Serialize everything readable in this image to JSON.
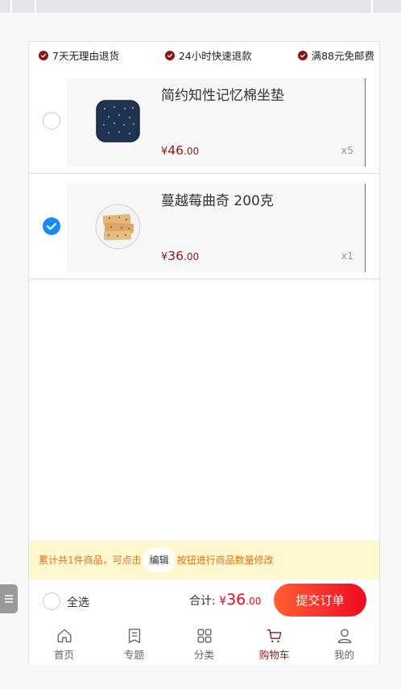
{
  "promises": [
    {
      "icon": "check-icon",
      "text": "7天无理由退货"
    },
    {
      "icon": "check-icon",
      "text": "24小时快速退款"
    },
    {
      "icon": "check-icon",
      "text": "满88元免邮费"
    }
  ],
  "cart": {
    "items": [
      {
        "name": "简约知性记忆棉坐垫",
        "price_symbol": "¥",
        "price_int": "46",
        "price_dec": ".00",
        "qty": "x5",
        "checked": false,
        "image": "cushion-image"
      },
      {
        "name": "蔓越莓曲奇 200克",
        "price_symbol": "¥",
        "price_int": "36",
        "price_dec": ".00",
        "qty": "x1",
        "checked": true,
        "image": "cookies-image"
      }
    ]
  },
  "notice": {
    "before": "累计共1件商品，可点击",
    "edit_label": "编辑",
    "after": "按钮进行商品数量修改"
  },
  "submit_bar": {
    "select_all_label": "全选",
    "total_label": "合计:",
    "total_symbol": "¥",
    "total_int": "36",
    "total_dec": ".00",
    "submit_label": "提交订单"
  },
  "tabbar": [
    {
      "icon": "home-icon",
      "label": "首页",
      "active": false
    },
    {
      "icon": "topic-icon",
      "label": "专题",
      "active": false
    },
    {
      "icon": "category-icon",
      "label": "分类",
      "active": false
    },
    {
      "icon": "cart-icon",
      "label": "购物车",
      "active": true
    },
    {
      "icon": "user-icon",
      "label": "我的",
      "active": false
    }
  ],
  "colors": {
    "accent": "#8b1a1a",
    "price_red": "#ee0a24",
    "checked_blue": "#1989fa",
    "notice_bg": "#fff7cd"
  }
}
